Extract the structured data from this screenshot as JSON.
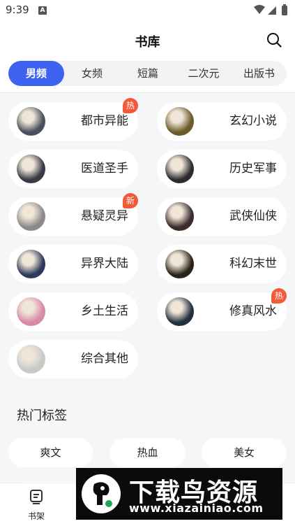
{
  "status_bar": {
    "time": "9:39",
    "notification": "A"
  },
  "header": {
    "title": "书库"
  },
  "tabs": [
    {
      "label": "男频",
      "active": true
    },
    {
      "label": "女频",
      "active": false
    },
    {
      "label": "短篇",
      "active": false
    },
    {
      "label": "二次元",
      "active": false
    },
    {
      "label": "出版书",
      "active": false
    }
  ],
  "categories": [
    {
      "label": "都市异能",
      "badge": "热",
      "cover_color": "#4a4f5c"
    },
    {
      "label": "玄幻小说",
      "badge": "",
      "cover_color": "#6b5a2a"
    },
    {
      "label": "医道圣手",
      "badge": "",
      "cover_color": "#3a3a44"
    },
    {
      "label": "历史军事",
      "badge": "",
      "cover_color": "#2c2c30"
    },
    {
      "label": "悬疑灵异",
      "badge": "新",
      "cover_color": "#8a8a8a"
    },
    {
      "label": "武侠仙侠",
      "badge": "",
      "cover_color": "#3b2b2b"
    },
    {
      "label": "异界大陆",
      "badge": "",
      "cover_color": "#2d3a5a"
    },
    {
      "label": "科幻末世",
      "badge": "",
      "cover_color": "#2a2418"
    },
    {
      "label": "乡土生活",
      "badge": "",
      "cover_color": "#d98aa6"
    },
    {
      "label": "修真风水",
      "badge": "热",
      "cover_color": "#24303e"
    },
    {
      "label": "综合其他",
      "badge": "",
      "cover_color": "#c9c9c9"
    }
  ],
  "hot_tags": {
    "title": "热门标签",
    "items": [
      "爽文",
      "热血",
      "美女"
    ]
  },
  "bottom_nav": {
    "items": [
      {
        "label": "书架"
      }
    ]
  },
  "watermark": {
    "title": "下载鸟资源",
    "url": "www.xiazainiao.com"
  },
  "colors": {
    "accent": "#3e63f0",
    "badge": "#f25a3a",
    "background": "#f5f6f8"
  }
}
